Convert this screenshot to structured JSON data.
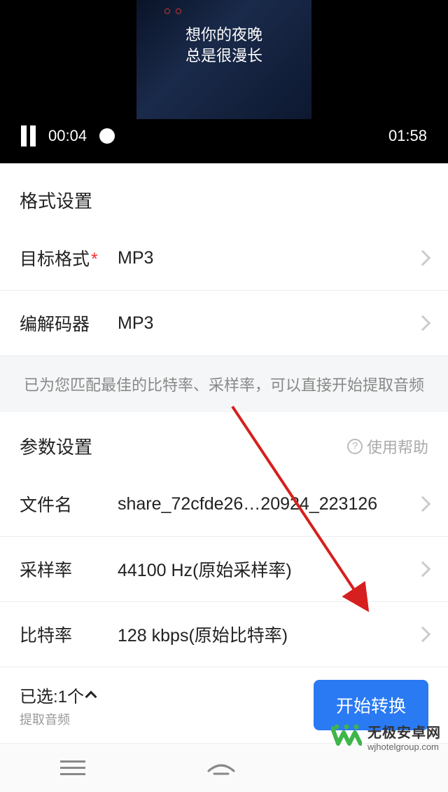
{
  "video": {
    "lyric1": "想你的夜晚",
    "lyric2": "总是很漫长",
    "current_time": "00:04",
    "total_time": "01:58"
  },
  "format_section": {
    "title": "格式设置",
    "target_label": "目标格式",
    "target_value": "MP3",
    "codec_label": "编解码器",
    "codec_value": "MP3"
  },
  "hint": "已为您匹配最佳的比特率、采样率，可以直接开始提取音频",
  "param_section": {
    "title": "参数设置",
    "help_label": "使用帮助",
    "filename_label": "文件名",
    "filename_value": "share_72cfde26…20924_223126",
    "samplerate_label": "采样率",
    "samplerate_value": "44100 Hz(原始采样率)",
    "bitrate_label": "比特率",
    "bitrate_value": "128 kbps(原始比特率)"
  },
  "bottom": {
    "selected_label": "已选:1个",
    "selected_sub": "提取音频",
    "convert_label": "开始转换"
  },
  "watermark": {
    "title": "无极安卓网",
    "url": "wjhotelgroup.com"
  }
}
